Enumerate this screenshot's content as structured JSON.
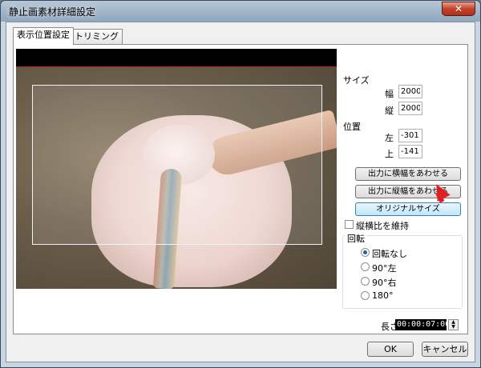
{
  "window": {
    "title": "静止画素材詳細設定",
    "close_glyph": "✕"
  },
  "tabs": [
    {
      "label": "表示位置設定",
      "active": true
    },
    {
      "label": "トリミング",
      "active": false
    }
  ],
  "size": {
    "header": "サイズ",
    "width_label": "幅",
    "width_value": "2000",
    "height_label": "縦",
    "height_value": "2000"
  },
  "position": {
    "header": "位置",
    "left_label": "左",
    "left_value": "-301",
    "top_label": "上",
    "top_value": "-141"
  },
  "buttons": {
    "fit_width": "出力に横幅をあわせる",
    "fit_height": "出力に縦幅をあわせる",
    "original_size": "オリジナルサイズ",
    "ok": "OK",
    "cancel": "キャンセル"
  },
  "keep_aspect": {
    "label": "縦横比を維持",
    "checked": false
  },
  "rotation": {
    "header": "回転",
    "options": [
      "回転なし",
      "90°左",
      "90°右",
      "180°"
    ],
    "selected": "回転なし"
  },
  "duration": {
    "label": "長さ",
    "value": "00:00:07:00"
  },
  "icons": {
    "close": "close-icon",
    "cursor": "mouse-pointer-icon"
  },
  "colors": {
    "cursor": "#e02020",
    "button_hover": "#bee6fd"
  }
}
